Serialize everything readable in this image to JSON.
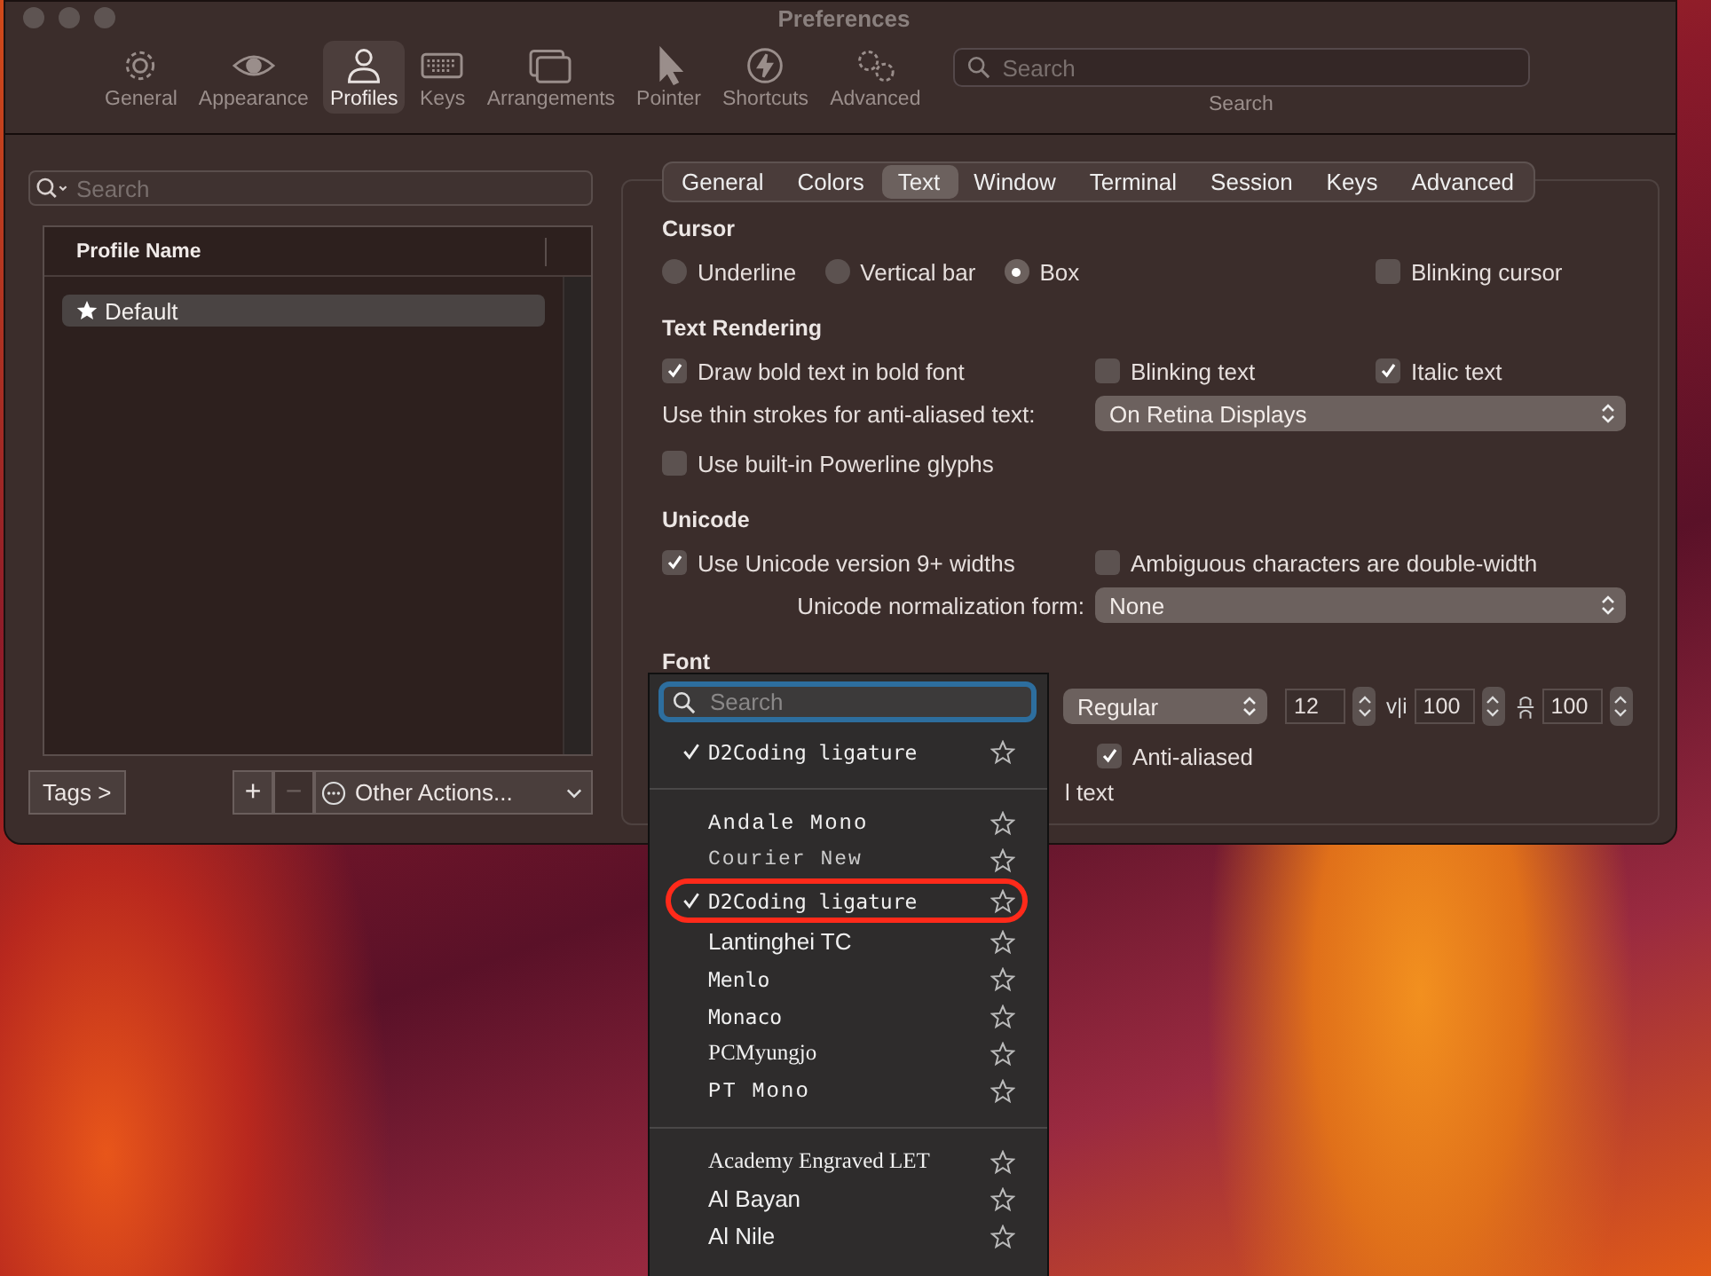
{
  "window": {
    "title": "Preferences"
  },
  "toolbar": {
    "items": [
      {
        "label": "General",
        "selected": false
      },
      {
        "label": "Appearance",
        "selected": false
      },
      {
        "label": "Profiles",
        "selected": true
      },
      {
        "label": "Keys",
        "selected": false
      },
      {
        "label": "Arrangements",
        "selected": false
      },
      {
        "label": "Pointer",
        "selected": false
      },
      {
        "label": "Shortcuts",
        "selected": false
      },
      {
        "label": "Advanced",
        "selected": false
      }
    ],
    "search": {
      "placeholder": "Search",
      "caption": "Search"
    }
  },
  "profiles": {
    "search_placeholder": "Search",
    "column": "Profile Name",
    "rows": [
      {
        "name": "Default",
        "selected": true
      }
    ],
    "tags": "Tags >",
    "add": {
      "label": "+",
      "disabled": false
    },
    "remove": {
      "label": "−",
      "disabled": true
    },
    "other_actions": "Other Actions..."
  },
  "tabs": [
    {
      "label": "General",
      "selected": false
    },
    {
      "label": "Colors",
      "selected": false
    },
    {
      "label": "Text",
      "selected": true
    },
    {
      "label": "Window",
      "selected": false
    },
    {
      "label": "Terminal",
      "selected": false
    },
    {
      "label": "Session",
      "selected": false
    },
    {
      "label": "Keys",
      "selected": false
    },
    {
      "label": "Advanced",
      "selected": false
    }
  ],
  "cursor": {
    "title": "Cursor",
    "options": [
      {
        "label": "Underline",
        "selected": false
      },
      {
        "label": "Vertical bar",
        "selected": false
      },
      {
        "label": "Box",
        "selected": true
      }
    ],
    "blinking": {
      "label": "Blinking cursor",
      "checked": false
    }
  },
  "text_rendering": {
    "title": "Text Rendering",
    "checks": [
      {
        "label": "Draw bold text in bold font",
        "checked": true
      },
      {
        "label": "Blinking text",
        "checked": false
      },
      {
        "label": "Italic text",
        "checked": true
      }
    ],
    "thin_strokes": {
      "label": "Use thin strokes for anti-aliased text:",
      "value": "On Retina Displays"
    },
    "powerline": {
      "label": "Use built-in Powerline glyphs",
      "checked": false
    }
  },
  "unicode": {
    "title": "Unicode",
    "checks": [
      {
        "label": "Use Unicode version 9+ widths",
        "checked": true
      },
      {
        "label": "Ambiguous characters are double-width",
        "checked": false
      }
    ],
    "normalization": {
      "label": "Unicode normalization form:",
      "value": "None"
    }
  },
  "font": {
    "title": "Font",
    "weight": "Regular",
    "size": "12",
    "h_spacing_glyph": "v|i",
    "h_spacing": "100",
    "v_spacing": "100",
    "anti_aliased": {
      "label": "Anti-aliased",
      "checked": true
    },
    "partial_label": "l text"
  },
  "font_menu": {
    "search_placeholder": "Search",
    "groups": [
      {
        "items": [
          {
            "name": "D2Coding ligature",
            "checked": true,
            "circled": false
          }
        ]
      },
      {
        "items": [
          {
            "name": "Andale Mono",
            "checked": false,
            "circled": false
          },
          {
            "name": "Courier New",
            "checked": false,
            "circled": false
          },
          {
            "name": "D2Coding ligature",
            "checked": true,
            "circled": true
          },
          {
            "name": "Lantinghei TC",
            "checked": false,
            "circled": false
          },
          {
            "name": "Menlo",
            "checked": false,
            "circled": false
          },
          {
            "name": "Monaco",
            "checked": false,
            "circled": false
          },
          {
            "name": "PCMyungjo",
            "checked": false,
            "circled": false
          },
          {
            "name": "PT Mono",
            "checked": false,
            "circled": false
          }
        ]
      },
      {
        "items": [
          {
            "name": "Academy Engraved LET",
            "checked": false,
            "circled": false
          },
          {
            "name": "Al Bayan",
            "checked": false,
            "circled": false
          },
          {
            "name": "Al Nile",
            "checked": false,
            "circled": false
          }
        ]
      }
    ]
  }
}
